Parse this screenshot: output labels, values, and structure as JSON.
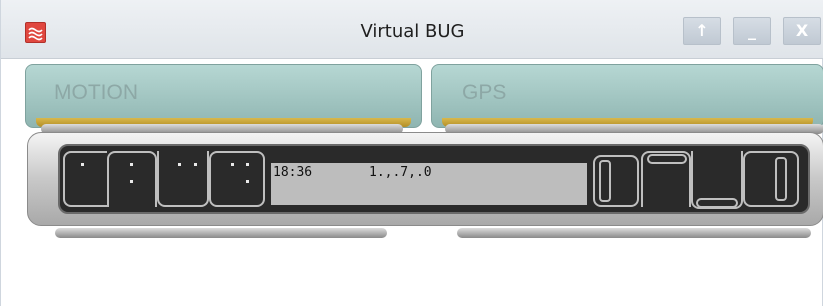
{
  "window": {
    "title": "Virtual BUG",
    "buttons": {
      "up": "↑",
      "minimize": "_",
      "close": "X"
    }
  },
  "tabs": [
    {
      "label": "MOTION"
    },
    {
      "label": "GPS"
    }
  ],
  "display": {
    "time": "18:36",
    "reading": "1.,.7,.0"
  },
  "colors": {
    "button_face": "#9fc3bf",
    "button_accent": "#c8a236",
    "lcd_background": "#bdbdbd",
    "screen_background": "#2a2a2a",
    "app_icon": "#e0473f"
  }
}
